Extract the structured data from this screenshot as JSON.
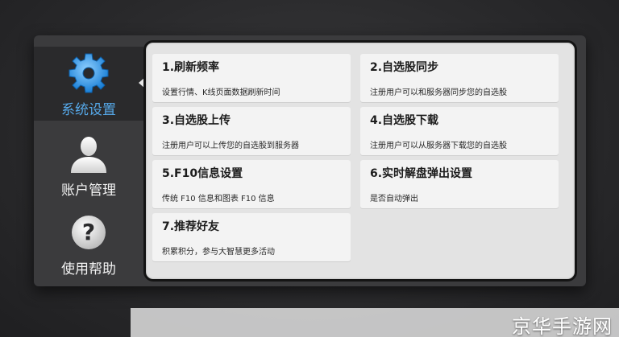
{
  "sidebar": {
    "items": [
      {
        "label": "系统设置",
        "icon": "gear-icon",
        "active": true
      },
      {
        "label": "账户管理",
        "icon": "user-icon",
        "active": false
      },
      {
        "label": "使用帮助",
        "icon": "question-icon",
        "active": false
      }
    ]
  },
  "settings": {
    "items": [
      {
        "title": "1.刷新频率",
        "desc": "设置行情、K线页面数据刷新时间"
      },
      {
        "title": "2.自选股同步",
        "desc": "注册用户可以和服务器同步您的自选股"
      },
      {
        "title": "3.自选股上传",
        "desc": "注册用户可以上传您的自选股到服务器"
      },
      {
        "title": "4.自选股下载",
        "desc": "注册用户可以从服务器下载您的自选股"
      },
      {
        "title": "5.F10信息设置",
        "desc": "传统 F10 信息和图表 F10 信息"
      },
      {
        "title": "6.实时解盘弹出设置",
        "desc": "是否自动弹出"
      },
      {
        "title": "7.推荐好友",
        "desc": "积累积分，参与大智慧更多活动"
      }
    ]
  },
  "watermark": {
    "text": "京华手游网"
  },
  "colors": {
    "accent": "#56a9ea",
    "panel": "#e3e3e3",
    "card": "#f3f3f3"
  }
}
